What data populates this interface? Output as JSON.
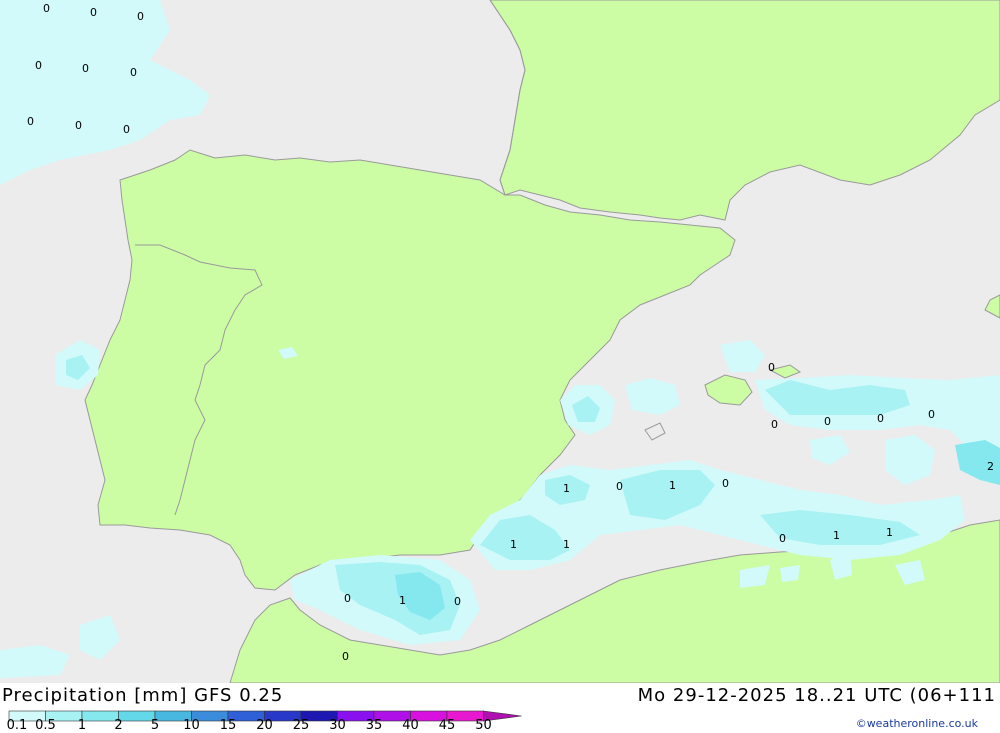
{
  "map": {
    "colors": {
      "sea": "#ececec",
      "land": "#ccfca4",
      "border": "#9a9a9a",
      "precip_light": "#d2fafa",
      "precip_mid": "#a8f2f4",
      "precip_heavy": "#6adce8"
    },
    "value_labels": [
      "0",
      "0",
      "0",
      "0",
      "0",
      "0",
      "0",
      "0",
      "0",
      "0",
      "0",
      "0",
      "1",
      "0",
      "1",
      "0",
      "1",
      "1",
      "0",
      "1",
      "0",
      "0",
      "1",
      "1",
      "0",
      "0",
      "0",
      "0",
      "2"
    ]
  },
  "footer": {
    "title": "Precipitation [mm] GFS 0.25",
    "datetime": "Mo 29-12-2025 18..21 UTC (06+111",
    "credit": "©weatheronline.co.uk"
  },
  "legend": {
    "ticks": [
      "0.1",
      "0.5",
      "1",
      "2",
      "5",
      "10",
      "15",
      "20",
      "25",
      "30",
      "35",
      "40",
      "45",
      "50"
    ],
    "colors": [
      "#d2fafa",
      "#a8f2f4",
      "#84e8ee",
      "#62d8e8",
      "#48b8e0",
      "#3c8cdc",
      "#3060d8",
      "#2838c8",
      "#1c18b0",
      "#8a10f0",
      "#b010e8",
      "#d810e0",
      "#e818d0",
      "#b010b0"
    ]
  }
}
